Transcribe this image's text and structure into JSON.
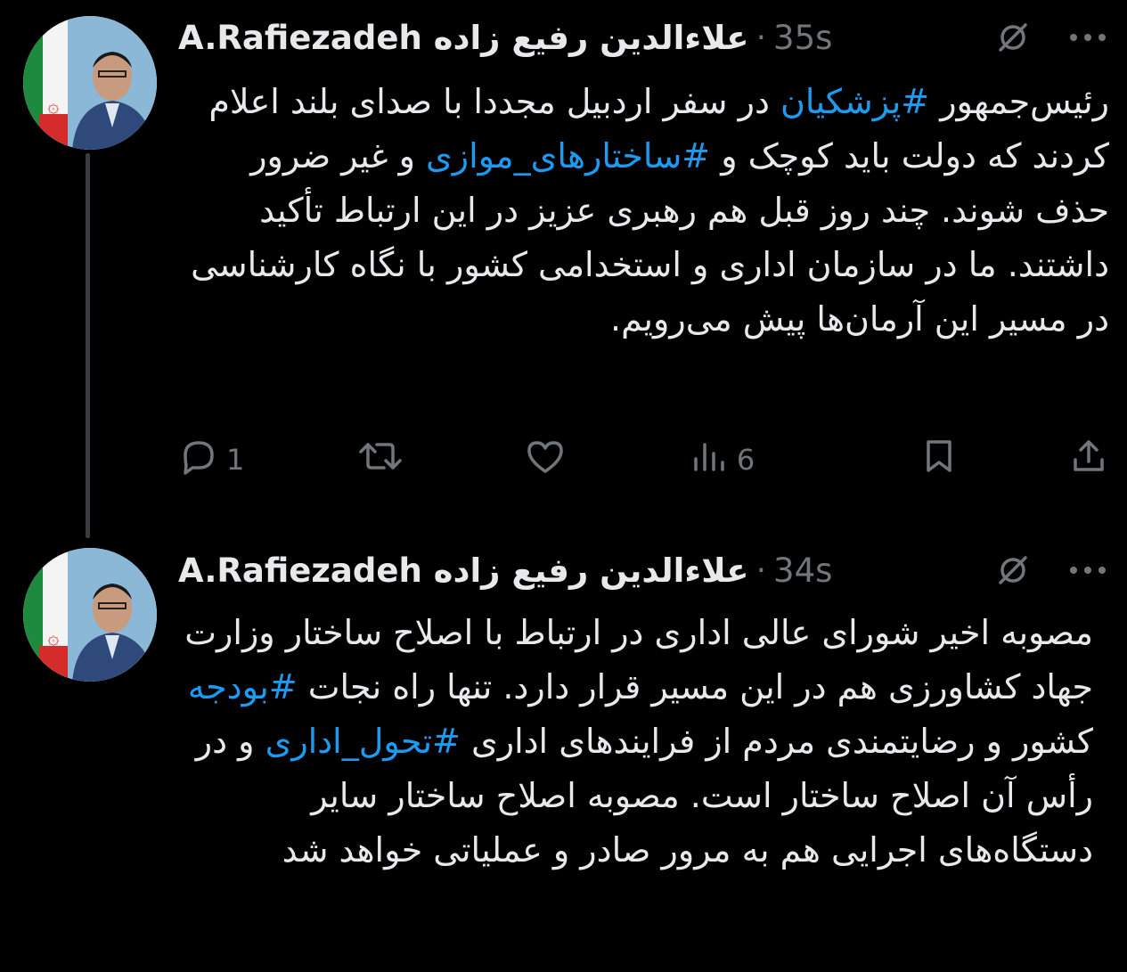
{
  "tweets": [
    {
      "display_name": "علاءالدین رفیع زاده",
      "handle": "A.Rafiezadeh",
      "separator": "·",
      "time": "35s",
      "text_parts": {
        "p1": "رئیس‌جمهور ",
        "h1": "#پزشکیان",
        "p2": " در سفر اردبیل مجددا با صدای بلند اعلام کردند که دولت باید کوچک و ",
        "h2": "#ساختارهای_موازی",
        "p3": " و غیر ضرور حذف شوند. چند روز قبل هم رهبری عزیز در این ارتباط تأکید داشتند. ما در سازمان اداری و استخدامی کشور با نگاه کارشناسی در مسیر این آرمان‌ها پیش می‌رویم."
      },
      "actions": {
        "reply_count": "1",
        "retweet_count": "",
        "like_count": "",
        "views_count": "6"
      }
    },
    {
      "display_name": "علاءالدین رفیع زاده",
      "handle": "A.Rafiezadeh",
      "separator": "·",
      "time": "34s",
      "text_parts": {
        "p1": "مصوبه اخیر شورای عالی اداری در ارتباط با اصلاح ساختار وزارت جهاد کشاورزی هم در این مسیر قرار دارد. تنها راه نجات ",
        "h1": "#بودجه",
        "p2": " کشور و رضایتمندی مردم از فرایندهای اداری ",
        "h2": "#تحول_اداری",
        "p3": " و در رأس آن اصلاح ساختار  است. مصوبه اصلاح ساختار سایر دستگاه‌های اجرایی هم به مرور صادر و عملیاتی خواهد شد"
      }
    }
  ],
  "colors": {
    "background": "#000000",
    "text": "#e7e9ea",
    "muted": "#71767b",
    "hashtag": "#1d9bf0",
    "thread_line": "#3a3d40"
  },
  "icons": [
    "avatar",
    "grok-icon",
    "more-icon",
    "reply-icon",
    "retweet-icon",
    "like-icon",
    "views-icon",
    "bookmark-icon",
    "share-icon"
  ]
}
